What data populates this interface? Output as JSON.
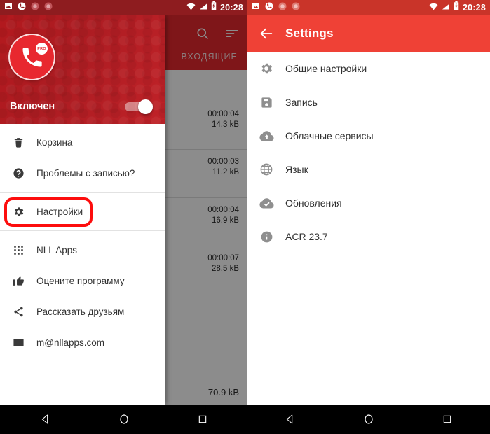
{
  "left_phone": {
    "status_bar": {
      "time": "20:28",
      "notification_icons": [
        "image-icon",
        "phone-call-icon",
        "record-dot-icon",
        "record-dot-icon"
      ],
      "system_icons": [
        "wifi-icon",
        "signal-icon",
        "battery-charging-icon"
      ]
    },
    "drawer": {
      "app_logo_badge": "PRO",
      "enabled_label": "Включен",
      "switch_state": "on",
      "items": [
        {
          "label": "Корзина",
          "icon": "trash-icon"
        },
        {
          "label": "Проблемы с записью?",
          "icon": "help-circle-icon"
        },
        {
          "label": "Настройки",
          "icon": "gear-icon",
          "highlighted": true
        },
        {
          "label": "NLL Apps",
          "icon": "apps-grid-icon"
        },
        {
          "label": "Оцените программу",
          "icon": "thumbs-up-icon"
        },
        {
          "label": "Рассказать друзьям",
          "icon": "share-icon"
        },
        {
          "label": "m@nllapps.com",
          "icon": "mail-icon"
        }
      ],
      "highlight_color": "#fd0d0d"
    },
    "calls_app": {
      "tab_label": "ВХОДЯЩИЕ",
      "actions": [
        "search-icon",
        "sort-icon"
      ],
      "rows": [
        {
          "duration": "",
          "size": ""
        },
        {
          "duration": "00:00:04",
          "size": "14.3 kB"
        },
        {
          "duration": "00:00:03",
          "size": "11.2 kB"
        },
        {
          "duration": "00:00:04",
          "size": "16.9 kB"
        },
        {
          "duration": "00:00:07",
          "size": "28.5 kB"
        }
      ],
      "total": "70.9 kB"
    },
    "nav_bar": {
      "buttons": [
        "back-icon",
        "home-icon",
        "recents-icon"
      ]
    }
  },
  "right_phone": {
    "status_bar": {
      "time": "20:28",
      "notification_icons": [
        "image-icon",
        "phone-call-icon",
        "record-dot-icon",
        "record-dot-icon"
      ],
      "system_icons": [
        "wifi-icon",
        "signal-icon",
        "battery-charging-icon"
      ]
    },
    "app_bar": {
      "back": "arrow-back-icon",
      "title": "Settings",
      "color": "#ef4136"
    },
    "settings_items": [
      {
        "label": "Общие настройки",
        "icon": "gear-icon"
      },
      {
        "label": "Запись",
        "icon": "save-floppy-icon"
      },
      {
        "label": "Облачные сервисы",
        "icon": "cloud-upload-icon"
      },
      {
        "label": "Язык",
        "icon": "globe-icon"
      },
      {
        "label": "Обновления",
        "icon": "cloud-check-icon"
      },
      {
        "label": "ACR 23.7",
        "icon": "info-icon"
      }
    ],
    "nav_bar": {
      "buttons": [
        "back-icon",
        "home-icon",
        "recents-icon"
      ]
    }
  }
}
